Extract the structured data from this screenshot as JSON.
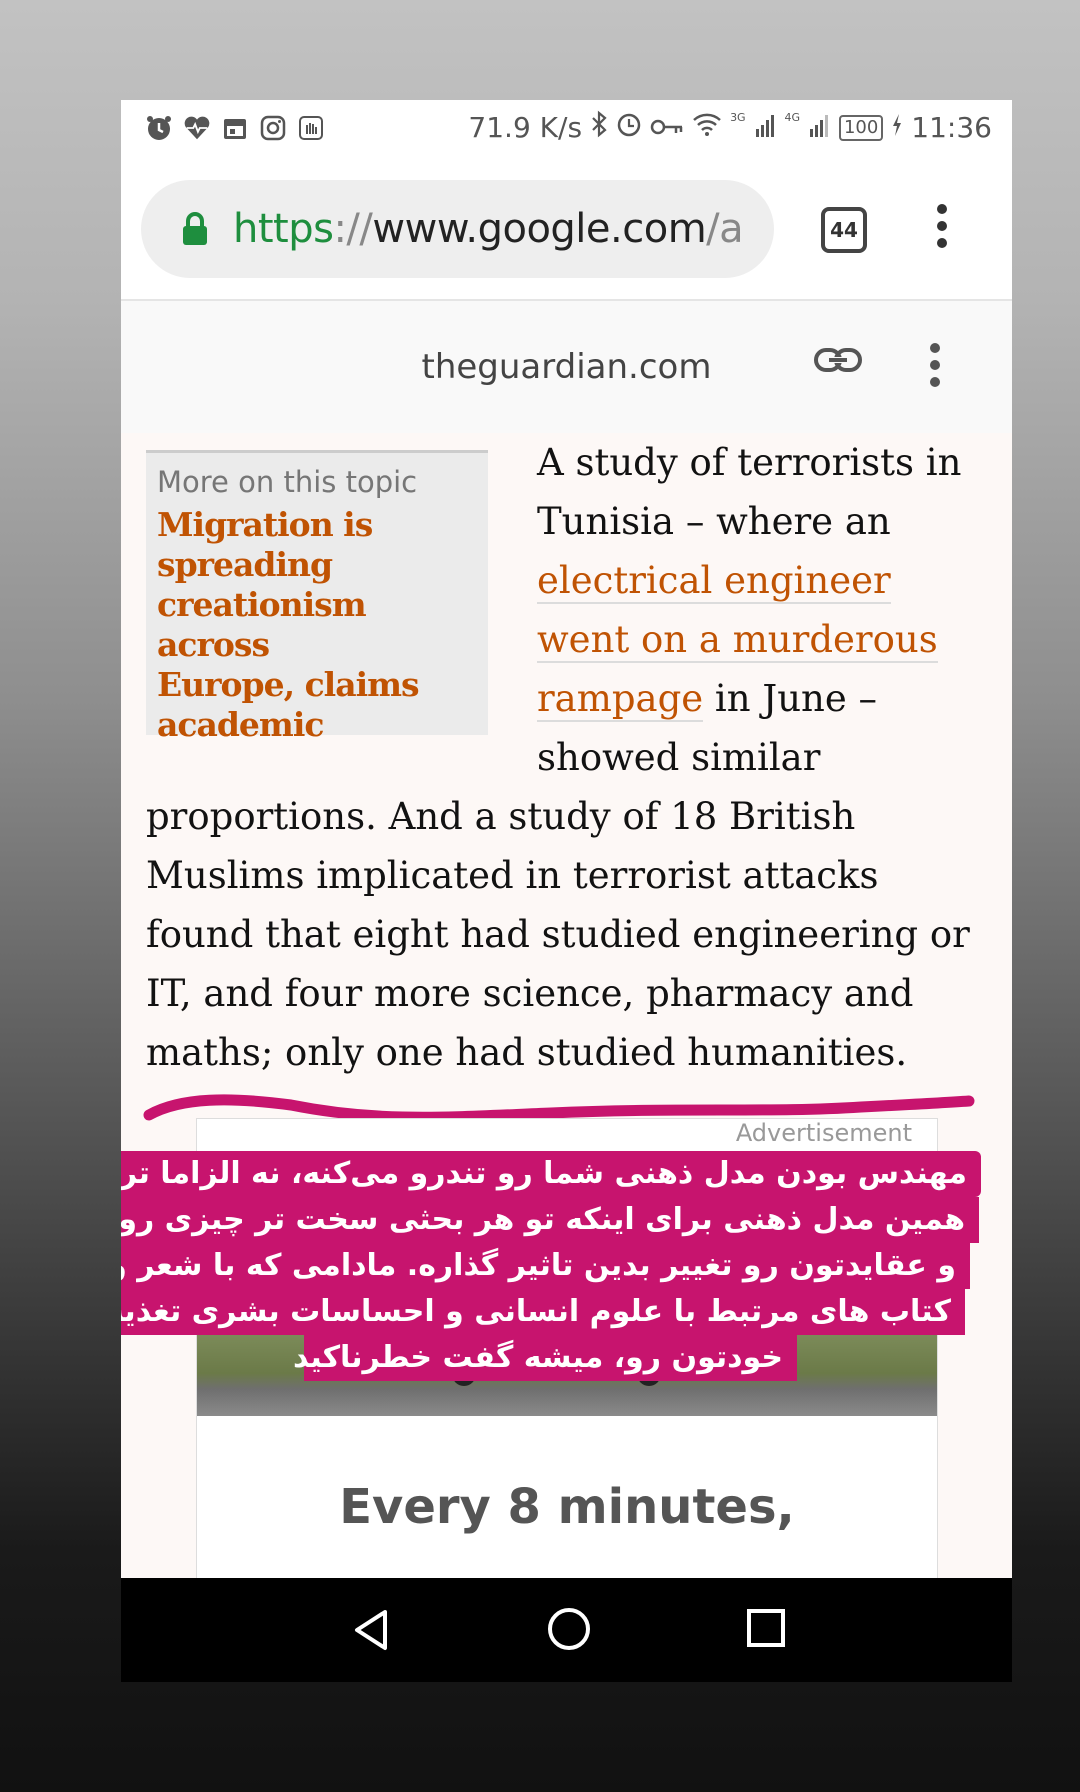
{
  "status_bar": {
    "left_icons": [
      "alarm-icon",
      "heart-rate-icon",
      "calendar-icon",
      "instagram-icon",
      "hand-icon"
    ],
    "speed": "71.9 K/s",
    "network_3g": "3G",
    "network_4g": "4G",
    "battery": "100",
    "time": "11:36"
  },
  "browser": {
    "url_scheme": "https",
    "url_sep": "://",
    "url_host": "www.google.com",
    "url_rest": "/amp",
    "tab_count": "44"
  },
  "amp_header": {
    "domain": "theguardian.com"
  },
  "article": {
    "topic_box": {
      "heading": "More on this topic",
      "link_lines": [
        "Migration is",
        "spreading",
        "creationism across",
        "Europe, claims",
        "academic"
      ]
    },
    "lines": [
      {
        "text": "A study of terrorists in"
      },
      {
        "text": "Tunisia – where an"
      },
      {
        "link": "electrical engineer"
      },
      {
        "link": "went on a murderous"
      },
      {
        "link": "rampage",
        "text": " in June –"
      },
      {
        "text": "showed similar"
      },
      {
        "text": "proportions. And a study of 18 British"
      },
      {
        "text": "Muslims implicated in terrorist attacks"
      },
      {
        "text": "found that eight had studied engineering or"
      },
      {
        "text": "IT, and four more science, pharmacy and"
      },
      {
        "text": "maths; only one had studied humanities."
      }
    ]
  },
  "ad": {
    "label": "Advertisement",
    "headline": "Every 8 minutes,"
  },
  "overlay_caption": {
    "lines": [
      "مهندس بودن مدل ذهنی شما رو تندرو می‌کنه، نه الزاما تروریست.",
      "همین مدل ذهنی برای اینکه تو هر بحثی سخت تر چیزی رو بپذیرید",
      "و عقایدتون رو تغییر بدین تاثیر گذاره. مادامی که با شعر و رمان و",
      "کتاب های مرتبط با علوم انسانی و احساسات بشری تغذیه نکنید",
      "خودتون رو، میشه گفت خطرناکید"
    ],
    "color": "#c7146e"
  },
  "colors": {
    "guardian_link": "#c05303",
    "annotation_stroke": "#c7146e"
  }
}
